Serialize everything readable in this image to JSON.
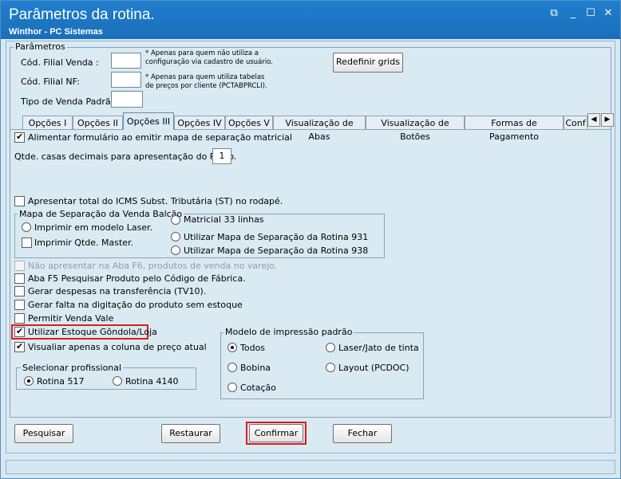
{
  "window": {
    "title": "Parâmetros da rotina.",
    "subtitle": "Winthor - PC Sistemas",
    "controls": {
      "restore": "⧉",
      "minimize": "_",
      "maximize": "☐",
      "close": "✕"
    }
  },
  "params": {
    "legend": "Parâmetros",
    "filial_venda_label": "Cód. Filial Venda :",
    "filial_venda_value": "",
    "filial_nf_label": "Cód. Filial NF:",
    "filial_nf_value": "",
    "tipo_venda_label": "Tipo de Venda Padrão:",
    "tipo_venda_value": "",
    "note1_line1": "* Apenas para quem não utiliza a",
    "note1_line2": "configuração via cadastro de usuário.",
    "note2_line1": "* Apenas para quem utiliza tabelas",
    "note2_line2": "de preços por cliente (PCTABPRCLI).",
    "redefinir_label": "Redefinir grids"
  },
  "tabs": [
    {
      "label": "Opções I"
    },
    {
      "label": "Opções II"
    },
    {
      "label": "Opções III"
    },
    {
      "label": "Opções IV"
    },
    {
      "label": "Opções V"
    },
    {
      "label": "Visualização de Abas"
    },
    {
      "label": "Visualização de Botões"
    },
    {
      "label": "Formas de Pagamento"
    },
    {
      "label": "Conf"
    }
  ],
  "tab_scroll": {
    "left": "◀",
    "right": "▶"
  },
  "options": {
    "alimentar": {
      "label": "Alimentar formulário ao emitir mapa de separação matricial",
      "checked": true
    },
    "qtde_casas_label": "Qtde. casas decimais para apresentação do Preço.",
    "qtde_casas_value": "1",
    "apresentar_icms": {
      "label": "Apresentar total do ICMS Subst. Tributária (ST) no rodapé.",
      "checked": false
    },
    "mapa": {
      "legend": "Mapa de Separação da Venda Balcão",
      "imprimir_laser": "Imprimir em modelo Laser.",
      "imprimir_qtde": "Imprimir Qtde. Master.",
      "matricial": "Matricial 33 linhas",
      "mapa_931": "Utilizar Mapa de Separação da Rotina 931",
      "mapa_938": "Utilizar Mapa de Separação  da Rotina 938"
    },
    "nao_apresentar": {
      "label": "Não apresentar na Aba F6, produtos de venda no varejo.",
      "checked": false
    },
    "aba_f5": {
      "label": "Aba F5 Pesquisar Produto pelo Código de Fábrica.",
      "checked": false
    },
    "gerar_despesas": {
      "label": "Gerar despesas na transferência (TV10).",
      "checked": false
    },
    "gerar_falta": {
      "label": "Gerar falta na digitação do produto sem estoque",
      "checked": false
    },
    "permitir_vale": {
      "label": "Permitir Venda Vale",
      "checked": false
    },
    "estoque_gondola": {
      "label": "Utilizar Estoque Gôndola/Loja",
      "checked": true
    },
    "visualizar_preco": {
      "label": "Visualiar apenas a coluna de preço atual",
      "checked": true
    },
    "profissional": {
      "legend": "Selecionar profissional",
      "rotina_517": "Rotina 517",
      "rotina_4140": "Rotina 4140",
      "selected": "Rotina 517"
    },
    "modelo": {
      "legend": "Modelo de impressão padrão",
      "todos": "Todos",
      "laser": "Laser/Jato de tinta",
      "bobina": "Bobina",
      "layout": "Layout (PCDOC)",
      "cotacao": "Cotação",
      "selected": "Todos"
    }
  },
  "buttons": {
    "pesquisar": "Pesquisar",
    "restaurar": "Restaurar",
    "confirmar": "Confirmar",
    "fechar": "Fechar"
  },
  "colors": {
    "titlebar": "#1a6eb8",
    "highlight": "#e01b1b",
    "background": "#d9eaf3"
  }
}
